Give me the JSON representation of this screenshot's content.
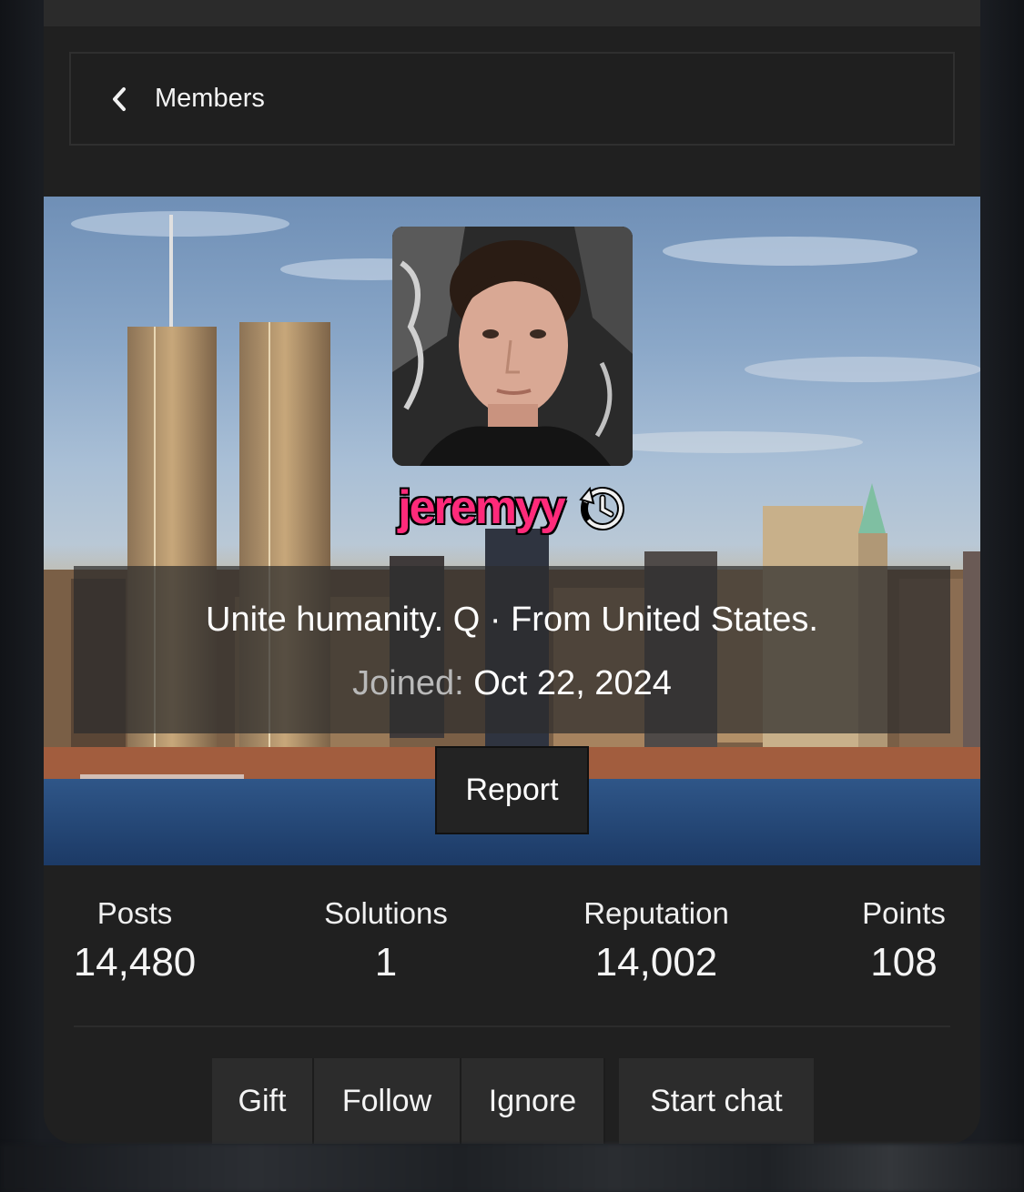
{
  "breadcrumb": {
    "label": "Members"
  },
  "profile": {
    "username": "jeremyy",
    "tagline": "Unite humanity. Q · From United States.",
    "joined_label": "Joined:",
    "joined_value": "Oct 22, 2024",
    "username_color": "#ff2a7a"
  },
  "report": {
    "label": "Report"
  },
  "stats": [
    {
      "label": "Posts",
      "value": "14,480"
    },
    {
      "label": "Solutions",
      "value": "1"
    },
    {
      "label": "Reputation",
      "value": "14,002"
    },
    {
      "label": "Points",
      "value": "108"
    }
  ],
  "actions": [
    {
      "label": "Gift"
    },
    {
      "label": "Follow"
    },
    {
      "label": "Ignore"
    },
    {
      "label": "Start chat"
    }
  ],
  "icons": {
    "back": "chevron-left-icon",
    "history": "history-icon"
  }
}
